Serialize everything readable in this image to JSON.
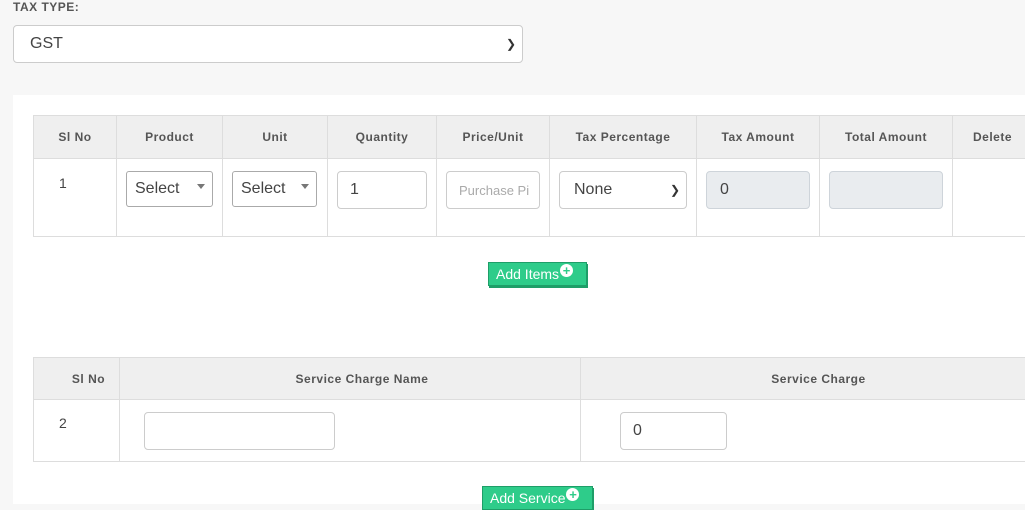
{
  "tax_type": {
    "label": "TAX TYPE:",
    "value": "GST"
  },
  "items_table": {
    "headers": [
      "Sl No",
      "Product",
      "Unit",
      "Quantity",
      "Price/Unit",
      "Tax Percentage",
      "Tax Amount",
      "Total Amount",
      "Delete"
    ],
    "row": {
      "sl_no": "1",
      "product": "Select",
      "unit": "Select",
      "quantity": "1",
      "price_placeholder": "Purchase Pi",
      "tax_percentage": "None",
      "tax_amount": "0",
      "total_amount": ""
    },
    "add_button": "Add Items"
  },
  "service_table": {
    "headers": [
      "Sl No",
      "Service Charge Name",
      "Service Charge"
    ],
    "row": {
      "sl_no": "2",
      "name": "",
      "charge": "0"
    },
    "add_button": "Add Service"
  },
  "colors": {
    "accent": "#2ecc8a",
    "header_bg": "#efefef",
    "disabled_bg": "#e9ecef"
  }
}
